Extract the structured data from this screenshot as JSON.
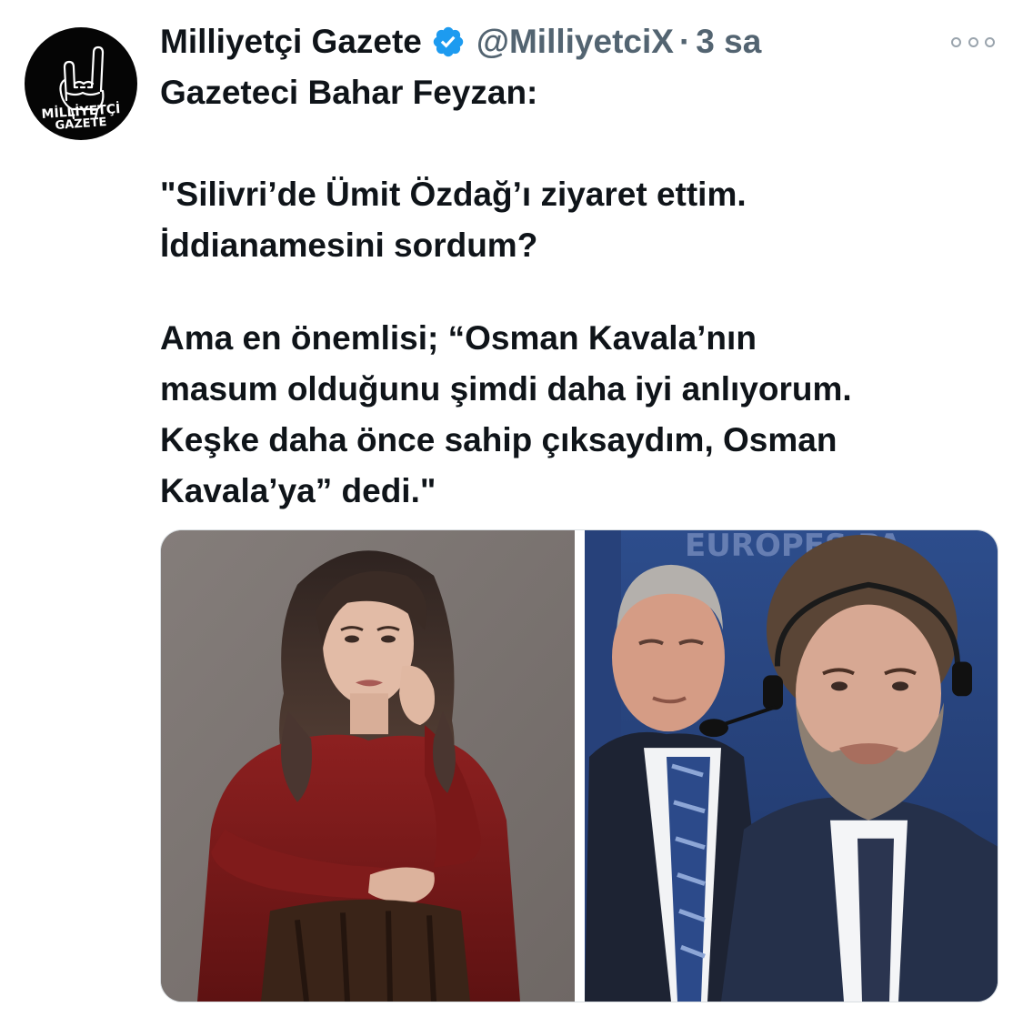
{
  "tweet": {
    "display_name": "Milliyetçi Gazete",
    "handle": "@MilliyetciX",
    "separator": "·",
    "time": "3 sa",
    "more_icon": "more-horizontal-icon",
    "verified_icon": "verified-badge-icon",
    "avatar": {
      "line1": "MİLLİYETÇİ",
      "line2": "GAZETE",
      "icon": "gray-wolf-hand-sign-icon"
    },
    "text": {
      "line1": "Gazeteci Bahar Feyzan:",
      "line2": "\"Silivri’de Ümit Özdağ’ı ziyaret ettim.",
      "line3": "İddianamesini sordum?",
      "line4": "Ama en önemlisi; “Osman Kavala’nın",
      "line5": "masum olduğunu şimdi daha iyi anlıyorum.",
      "line6": "Keşke daha önce sahip çıksaydım, Osman",
      "line7": "Kavala’ya” dedi.\""
    },
    "media": {
      "right_photo_backdrop_text": "EUROPES PA"
    }
  },
  "colors": {
    "text_primary": "#0f1419",
    "text_secondary": "#536471",
    "verified_blue": "#1d9bf0",
    "avatar_bg": "#050505"
  }
}
